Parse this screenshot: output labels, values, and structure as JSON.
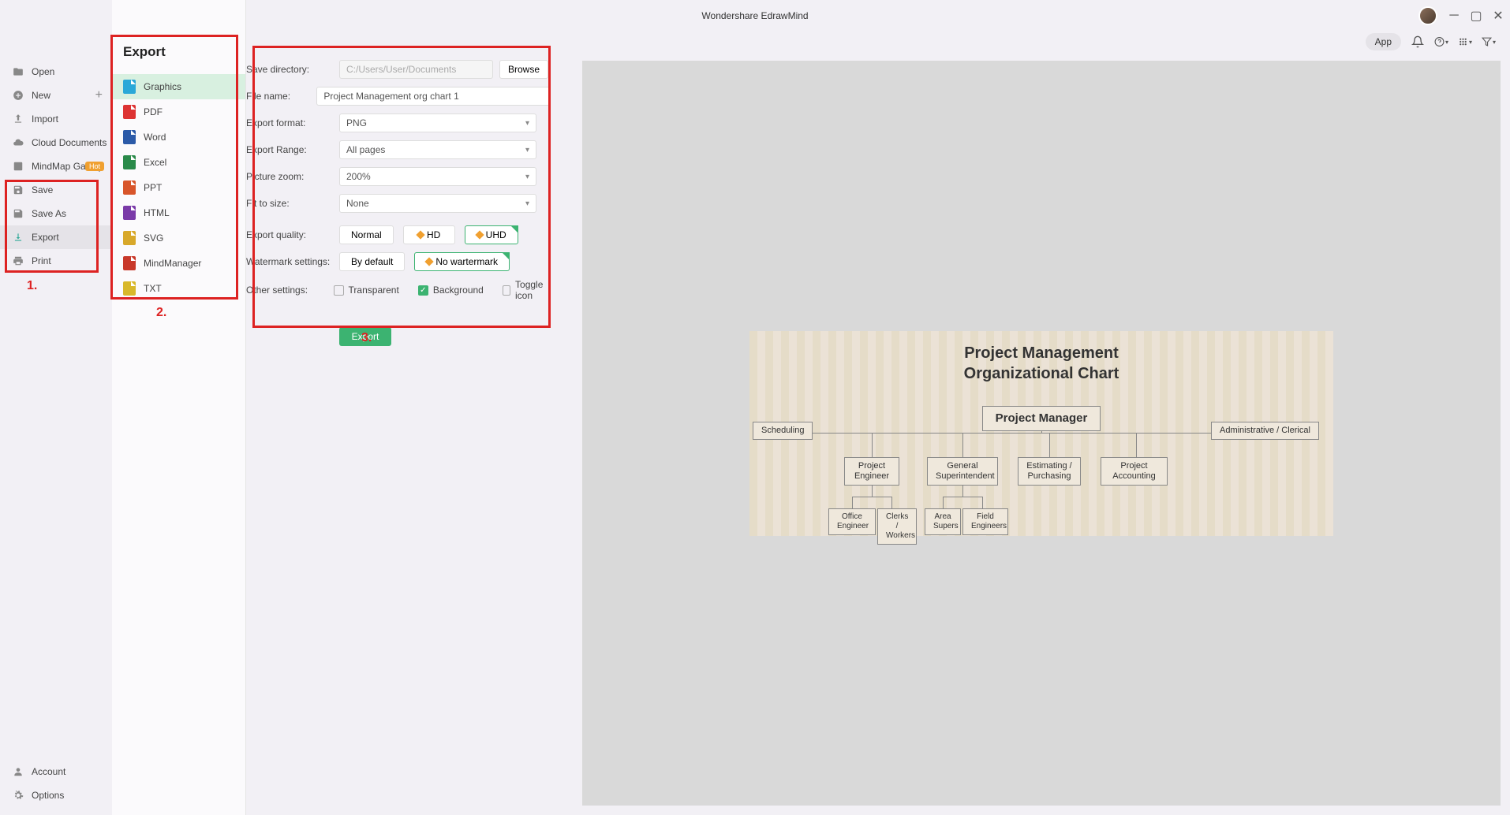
{
  "app": {
    "title": "Wondershare EdrawMind",
    "app_button": "App"
  },
  "sidebar": {
    "items": [
      {
        "label": "Open",
        "icon": "folder"
      },
      {
        "label": "New",
        "icon": "plus-circle",
        "has_plus": true
      },
      {
        "label": "Import",
        "icon": "import"
      },
      {
        "label": "Cloud Documents",
        "icon": "cloud"
      },
      {
        "label": "MindMap Gallery",
        "icon": "gallery",
        "badge": "Hot"
      },
      {
        "label": "Save",
        "icon": "save"
      },
      {
        "label": "Save As",
        "icon": "save-as"
      },
      {
        "label": "Export",
        "icon": "export",
        "selected": true
      },
      {
        "label": "Print",
        "icon": "print"
      }
    ],
    "bottom": [
      {
        "label": "Account",
        "icon": "account"
      },
      {
        "label": "Options",
        "icon": "gear"
      }
    ]
  },
  "export_panel": {
    "title": "Export",
    "items": [
      {
        "label": "Graphics",
        "color": "#2aa8d8",
        "selected": true
      },
      {
        "label": "PDF",
        "color": "#d33"
      },
      {
        "label": "Word",
        "color": "#2b5aa8"
      },
      {
        "label": "Excel",
        "color": "#2a8a4a"
      },
      {
        "label": "PPT",
        "color": "#d8552a"
      },
      {
        "label": "HTML",
        "color": "#7a3aa8"
      },
      {
        "label": "SVG",
        "color": "#d8a82a"
      },
      {
        "label": "MindManager",
        "color": "#c8382a"
      },
      {
        "label": "TXT",
        "color": "#d8b82a"
      }
    ]
  },
  "settings": {
    "save_dir_label": "Save directory:",
    "save_dir": "C:/Users/User/Documents",
    "browse": "Browse",
    "file_name_label": "File name:",
    "file_name": "Project Management org chart 1",
    "format_label": "Export format:",
    "format": "PNG",
    "range_label": "Export Range:",
    "range": "All pages",
    "zoom_label": "Picture zoom:",
    "zoom": "200%",
    "fit_label": "Fit to size:",
    "fit": "None",
    "quality_label": "Export quality:",
    "quality_opts": [
      "Normal",
      "HD",
      "UHD"
    ],
    "quality_selected": "UHD",
    "watermark_label": "Watermark settings:",
    "watermark_opts": [
      "By default",
      "No wartermark"
    ],
    "watermark_selected": "No wartermark",
    "other_label": "Other settings:",
    "checks": [
      {
        "label": "Transparent",
        "checked": false
      },
      {
        "label": "Background",
        "checked": true
      },
      {
        "label": "Toggle icon",
        "checked": false
      }
    ],
    "export_btn": "Export"
  },
  "annotations": {
    "a1": "1.",
    "a2": "2.",
    "a3": "3."
  },
  "preview": {
    "title1": "Project Management",
    "title2": "Organizational Chart",
    "nodes": {
      "pm": "Project Manager",
      "sched": "Scheduling",
      "admin": "Administrative / Clerical",
      "pe": "Project\nEngineer",
      "gs": "General\nSuperintendent",
      "ep": "Estimating /\nPurchasing",
      "pa": "Project\nAccounting",
      "oe": "Office\nEngineer",
      "cw": "Clerks /\nWorkers",
      "as": "Area\nSupers",
      "fe": "Field\nEngineers"
    }
  }
}
